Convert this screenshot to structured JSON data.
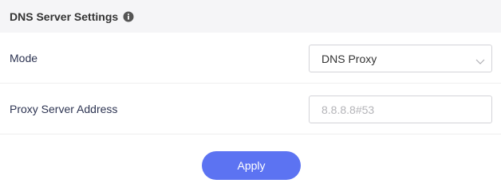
{
  "header": {
    "title": "DNS Server Settings",
    "info_icon": "info-icon"
  },
  "mode": {
    "label": "Mode",
    "selected": "DNS Proxy",
    "icon": "chevron-down-icon"
  },
  "proxy_server": {
    "label": "Proxy Server Address",
    "value": "",
    "placeholder": "8.8.8.8#53"
  },
  "apply": {
    "label": "Apply"
  },
  "colors": {
    "header_bg": "#f5f5f7",
    "accent": "#5c73f2",
    "label_text": "#2d3452",
    "border": "#d3d3d8",
    "placeholder": "#b4b4b8"
  }
}
